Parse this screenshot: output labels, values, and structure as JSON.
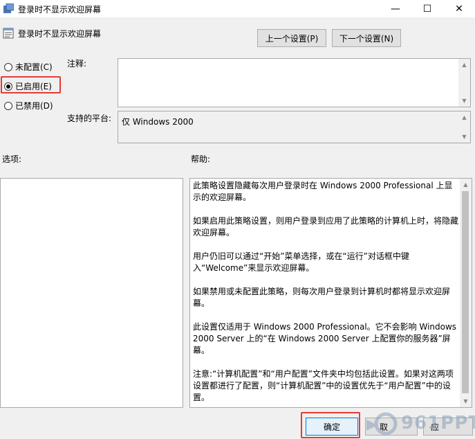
{
  "window": {
    "title": "登录时不显示欢迎屏幕",
    "minimize_glyph": "—",
    "maximize_glyph": "☐",
    "close_glyph": "✕"
  },
  "header": {
    "setting_title": "登录时不显示欢迎屏幕",
    "prev_label": "上一个设置(P)",
    "next_label": "下一个设置(N)"
  },
  "options": {
    "not_configured": "未配置(C)",
    "enabled": "已启用(E)",
    "disabled": "已禁用(D)",
    "selected": "enabled"
  },
  "comment": {
    "label": "注释:",
    "value": ""
  },
  "platform": {
    "label": "支持的平台:",
    "value": "仅 Windows 2000"
  },
  "sections": {
    "options_label": "选项:",
    "help_label": "帮助:"
  },
  "help": {
    "paragraphs": [
      "此策略设置隐藏每次用户登录时在 Windows 2000 Professional 上显示的欢迎屏幕。",
      "如果启用此策略设置，则用户登录到应用了此策略的计算机上时，将隐藏欢迎屏幕。",
      "用户仍旧可以通过“开始”菜单选择，或在“运行”对话框中键入“Welcome”来显示欢迎屏幕。",
      "如果禁用或未配置此策略，则每次用户登录到计算机时都将显示欢迎屏幕。",
      "此设置仅适用于 Windows 2000 Professional。它不会影响 Windows 2000 Server 上的“在 Windows 2000 Server 上配置你的服务器”屏幕。",
      "注意:“计算机配置”和“用户配置”文件夹中均包括此设置。如果对这两项设置都进行了配置，则“计算机配置”中的设置优先于“用户配置”中的设置。"
    ]
  },
  "footer": {
    "ok_label": "确定",
    "cancel_partial": "取",
    "apply_partial": "应"
  },
  "watermark": {
    "text": "961PPT"
  },
  "colors": {
    "highlight": "#e53935",
    "ok_border": "#0078d7"
  }
}
